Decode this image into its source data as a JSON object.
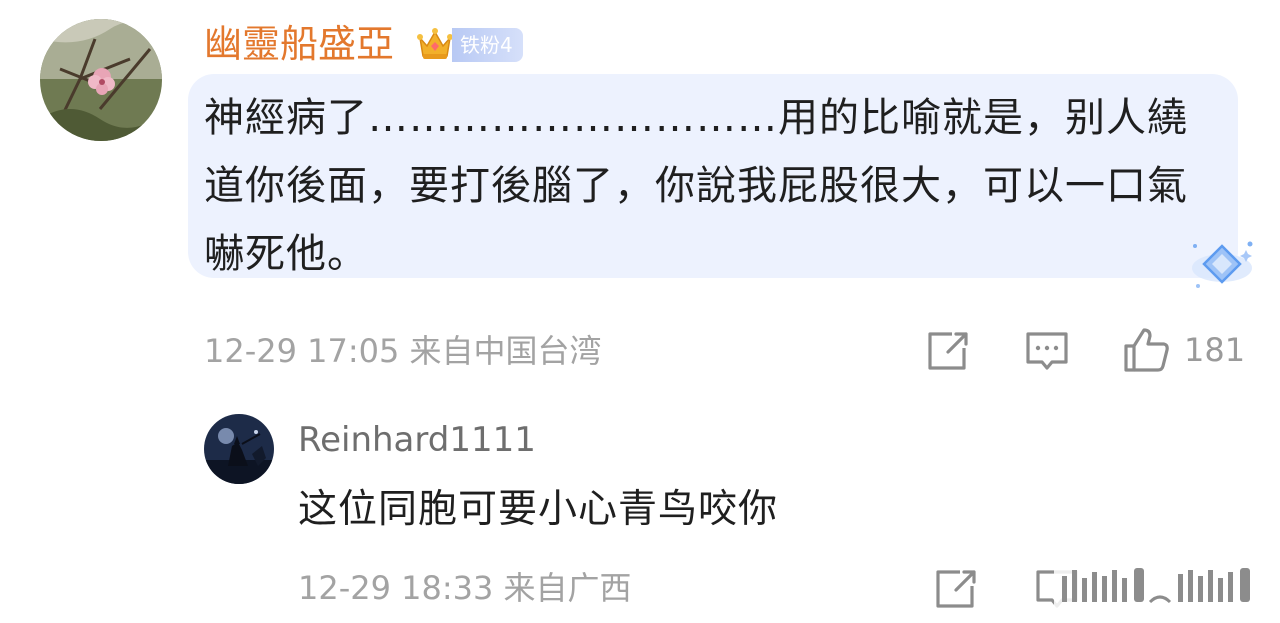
{
  "main_comment": {
    "username": "幽靈船盛亞",
    "fan_badge": "铁粉4",
    "text": "神經病了…………………………用的比喻就是，别人繞道你後面，要打後腦了，你說我屁股很大，可以一口氣嚇死他。",
    "date": "12-29 17:05",
    "location": "来自中国台湾",
    "like_count": "181",
    "icons": {
      "crown": "crown-icon",
      "share": "share-icon",
      "comment": "comment-icon",
      "like": "thumbs-up-icon",
      "decoration": "diamond-icon"
    }
  },
  "reply": {
    "username": "Reinhard1111",
    "text": "这位同胞可要小心青鸟咬你",
    "date": "12-29 18:33",
    "location": "来自广西",
    "icons": {
      "share": "share-icon",
      "comment": "comment-icon"
    }
  },
  "colors": {
    "username_accent": "#e3782d",
    "bubble_background": "#edf2fe",
    "meta_text": "#a3a3a3",
    "badge": "#b8c9f4"
  }
}
